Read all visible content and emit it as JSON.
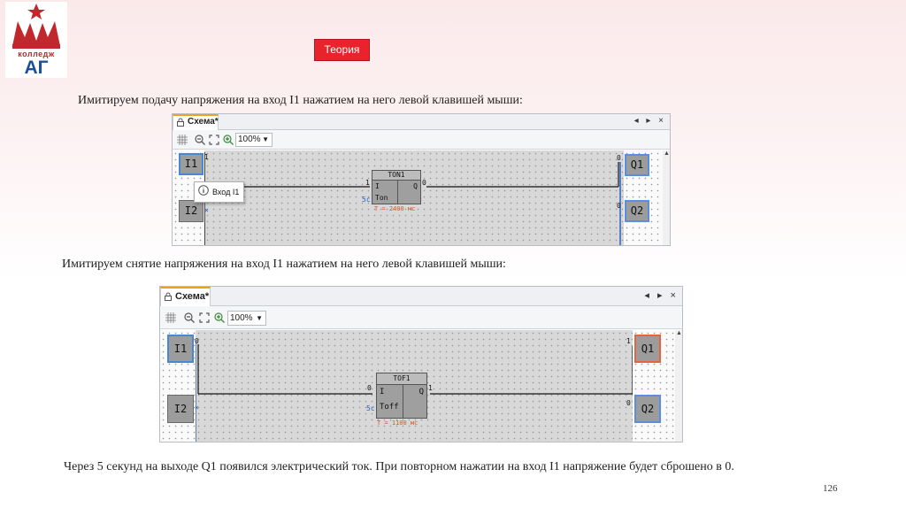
{
  "logo": {
    "text": "колледж",
    "letters": "АГ"
  },
  "theory_button": "Теория",
  "caption1": "Имитируем подачу напряжения на вход I1 нажатием на него левой клавишей мыши:",
  "caption2": "Имитируем снятие напряжения на вход I1 нажатием на него левой клавишей мыши:",
  "caption3": "Через 5 секунд на выходе Q1 появился электрический ток.  При повторном нажатии на вход I1 напряжение будет сброшено в 0.",
  "page_number": "126",
  "screen1": {
    "tab": "Схема*",
    "tab_controls": "◂ ▸ ×",
    "zoom": "100%",
    "inputs": [
      {
        "label": "I1",
        "value": "1"
      },
      {
        "label": "I2",
        "value": ""
      }
    ],
    "outputs": [
      {
        "label": "Q1",
        "value": "0"
      },
      {
        "label": "Q2",
        "value": "0"
      }
    ],
    "block": {
      "title": "TON1",
      "in_label": "I",
      "out_label": "Q",
      "mode": "Ton",
      "in_value": "1",
      "out_value": "0",
      "param_prefix": "5с",
      "param": "T = 2400 мс"
    },
    "tooltip": "Вход I1",
    "colors": {
      "active_input": "#4a86d6",
      "output_border": "#5b8ee0"
    }
  },
  "screen2": {
    "tab": "Схема*",
    "tab_controls": "◂ ▸ ×",
    "zoom": "100%",
    "inputs": [
      {
        "label": "I1",
        "value": "0"
      },
      {
        "label": "I2",
        "value": ""
      }
    ],
    "outputs": [
      {
        "label": "Q1",
        "value": "1"
      },
      {
        "label": "Q2",
        "value": "0"
      }
    ],
    "block": {
      "title": "TOF1",
      "in_label": "I",
      "out_label": "Q",
      "mode": "Toff",
      "in_value": "0",
      "out_value": "1",
      "param_prefix": "5с",
      "param": "T = 1100 мс"
    },
    "colors": {
      "active_output": "#e9643a",
      "output_border": "#5b8ee0"
    }
  }
}
